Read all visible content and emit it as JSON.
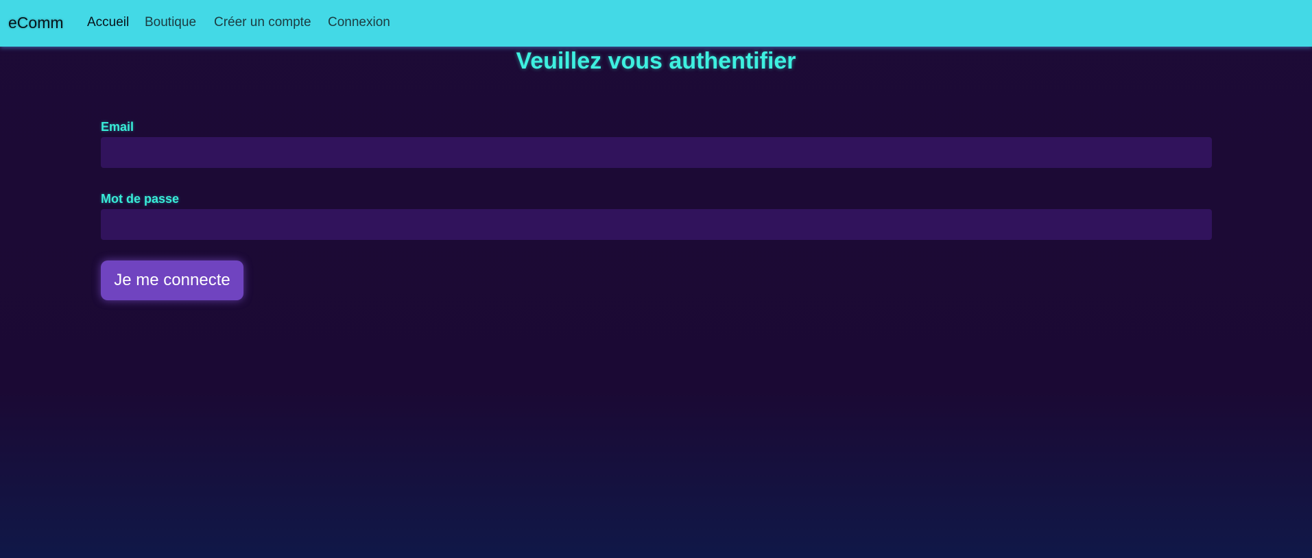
{
  "nav": {
    "brand": "eComm",
    "links": [
      "Accueil",
      "Boutique",
      "Créer un compte",
      "Connexion"
    ]
  },
  "main": {
    "title": "Veuillez vous authentifier",
    "email_label": "Email",
    "email_value": "",
    "password_label": "Mot de passe",
    "password_value": "",
    "submit_label": "Je me connecte"
  }
}
